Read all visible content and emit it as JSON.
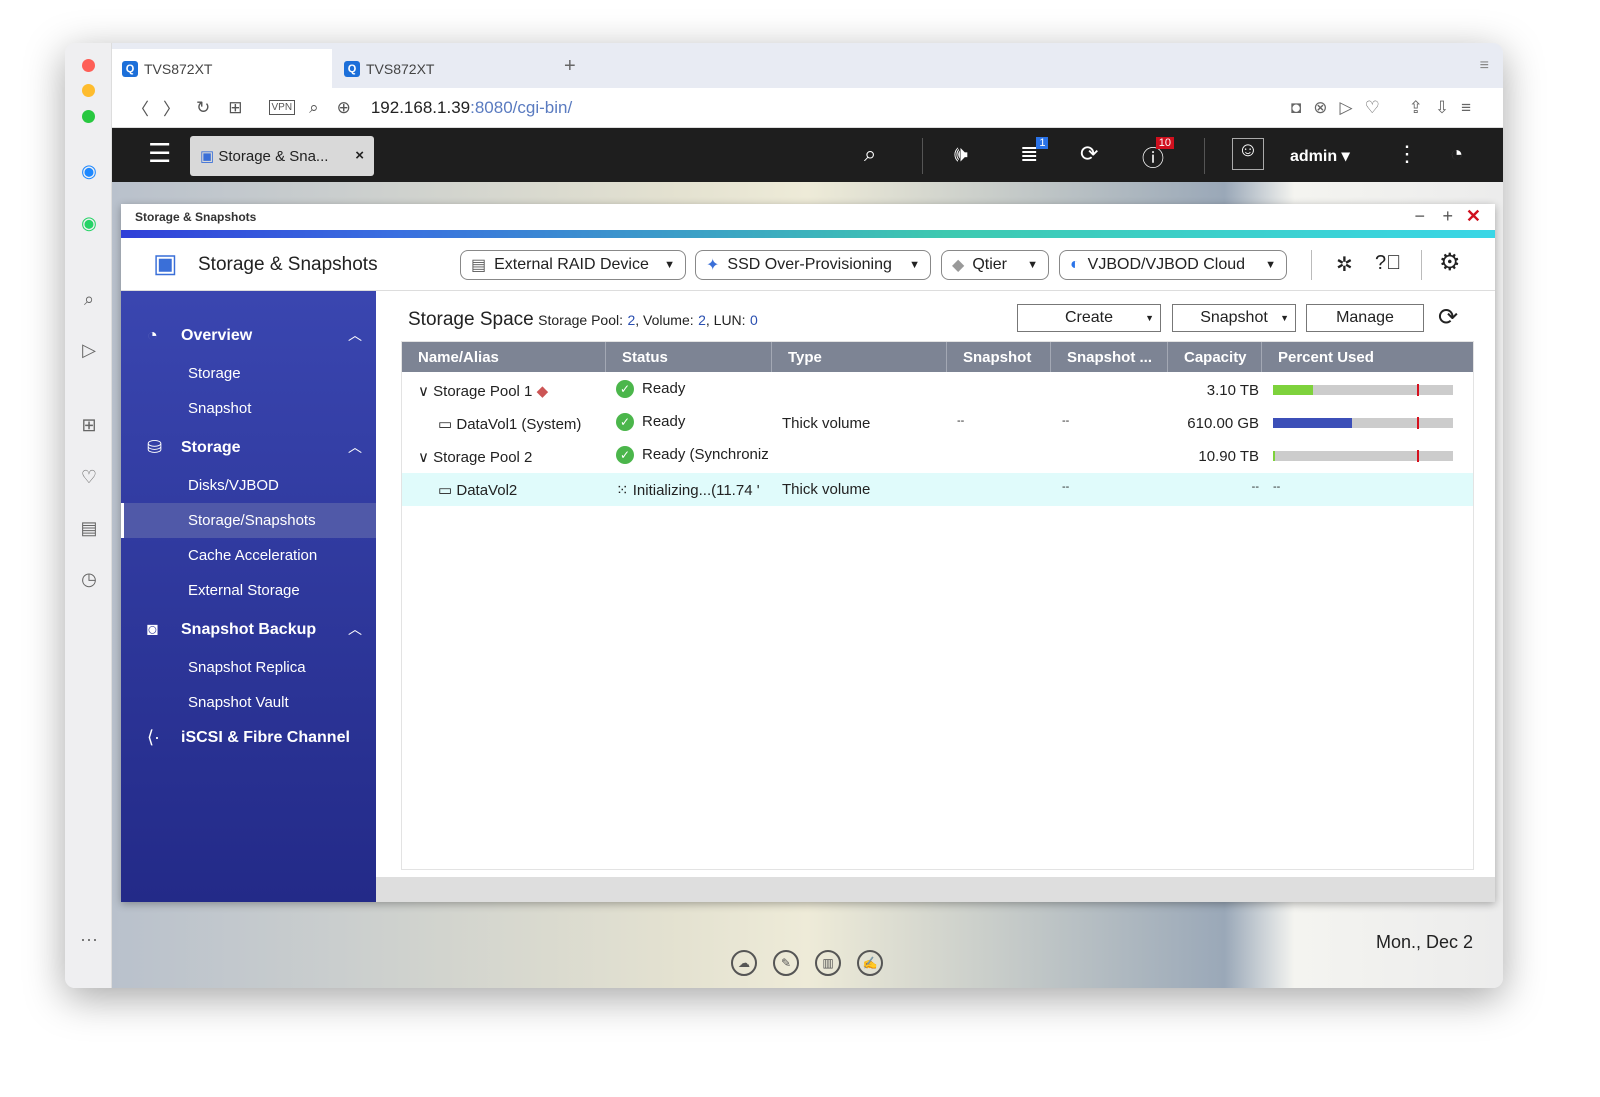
{
  "browser": {
    "tabs": [
      {
        "label": "TVS872XT"
      },
      {
        "label": "TVS872XT"
      }
    ],
    "new_tab": "+",
    "url_host": "192.168.1.39",
    "url_rest": ":8080/cgi-bin/",
    "vpn": "VPN"
  },
  "topbar": {
    "app_tab": "Storage & Sna...",
    "user": "admin ▾",
    "notif_count": "1",
    "info_count": "10"
  },
  "window": {
    "title": "Storage & Snapshots",
    "app_title": "Storage & Snapshots"
  },
  "header_buttons": [
    {
      "label": "External RAID Device"
    },
    {
      "label": "SSD Over-Provisioning"
    },
    {
      "label": "Qtier"
    },
    {
      "label": "VJBOD/VJBOD Cloud"
    }
  ],
  "nav": {
    "overview": "Overview",
    "overview_items": [
      "Storage",
      "Snapshot"
    ],
    "storage": "Storage",
    "storage_items": [
      "Disks/VJBOD",
      "Storage/Snapshots",
      "Cache Acceleration",
      "External Storage"
    ],
    "backup": "Snapshot Backup",
    "backup_items": [
      "Snapshot Replica",
      "Snapshot Vault"
    ],
    "iscsi": "iSCSI & Fibre Channel"
  },
  "main": {
    "title": "Storage Space",
    "pool_label": "Storage Pool:",
    "pool_count": "2",
    "volume_label": ", Volume:",
    "volume_count": "2",
    "lun_label": ", LUN:",
    "lun_count": "0",
    "create": "Create",
    "snapshot": "Snapshot",
    "manage": "Manage"
  },
  "table": {
    "columns": [
      "Name/Alias",
      "Status",
      "Type",
      "Snapshot",
      "Snapshot ...",
      "Capacity",
      "Percent Used"
    ],
    "rows": [
      {
        "name": "Storage Pool 1",
        "status": "Ready",
        "type": "",
        "snapshot": "",
        "snapshot2": "",
        "capacity": "3.10 TB",
        "used_pct": 22,
        "threshold_pct": 80,
        "bar_color": "#7ed23c"
      },
      {
        "name": "DataVol1 (System)",
        "status": "Ready",
        "type": "Thick volume",
        "snapshot": "--",
        "snapshot2": "--",
        "capacity": "610.00 GB",
        "used_pct": 44,
        "threshold_pct": 80,
        "bar_color": "#3c4fb8"
      },
      {
        "name": "Storage Pool 2",
        "status": "Ready (Synchroniz",
        "type": "",
        "snapshot": "",
        "snapshot2": "",
        "capacity": "10.90 TB",
        "used_pct": 1,
        "threshold_pct": 80,
        "bar_color": "#7ed23c"
      },
      {
        "name": "DataVol2",
        "status": "Initializing...(11.74 '",
        "type": "Thick volume",
        "snapshot": "",
        "snapshot2": "--",
        "capacity": "--",
        "percent": "--"
      }
    ]
  },
  "desktop": {
    "date": "Mon., Dec 2"
  }
}
